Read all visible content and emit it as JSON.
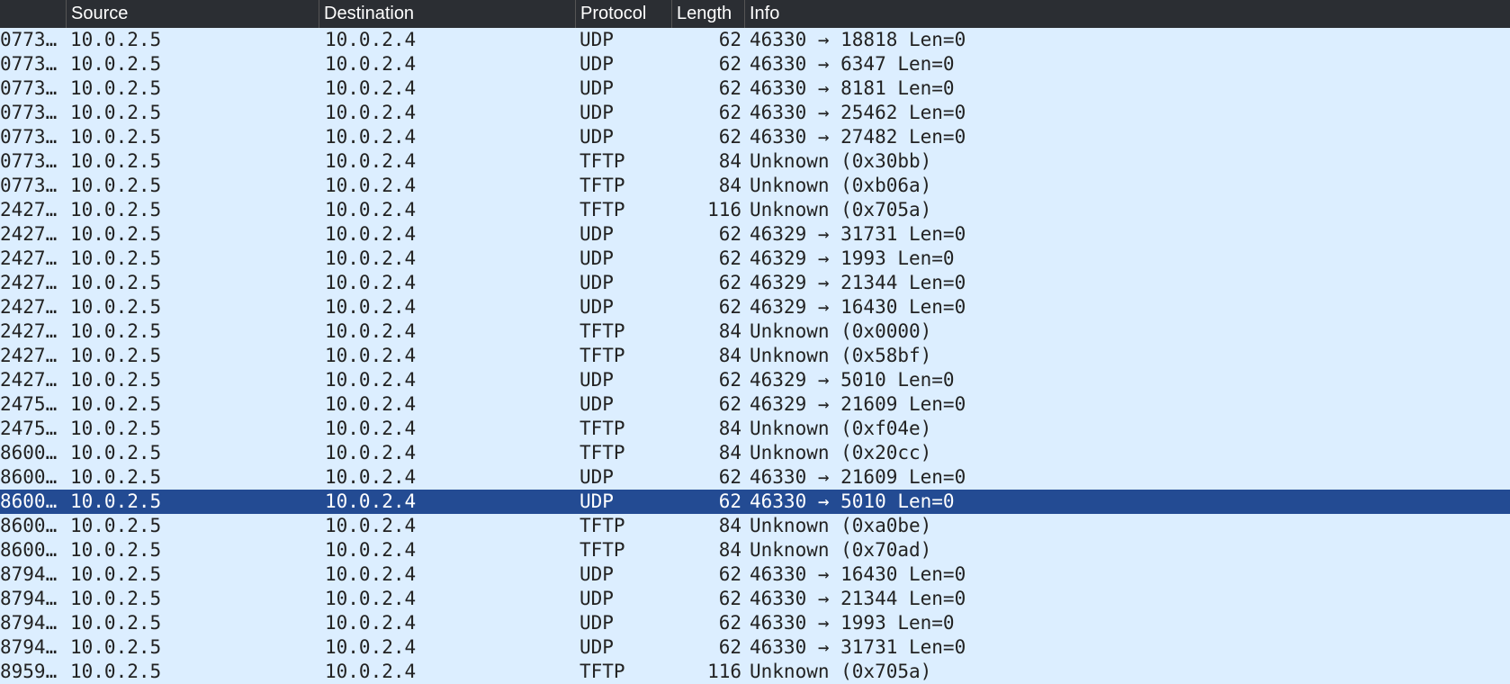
{
  "columns": {
    "time": "",
    "source": "Source",
    "destination": "Destination",
    "protocol": "Protocol",
    "length": "Length",
    "info": "Info"
  },
  "packets": [
    {
      "t": "0773…",
      "src": "10.0.2.5",
      "dst": "10.0.2.4",
      "proto": "UDP",
      "len": "62",
      "info": "46330 → 18818 Len=0"
    },
    {
      "t": "0773…",
      "src": "10.0.2.5",
      "dst": "10.0.2.4",
      "proto": "UDP",
      "len": "62",
      "info": "46330 → 6347 Len=0"
    },
    {
      "t": "0773…",
      "src": "10.0.2.5",
      "dst": "10.0.2.4",
      "proto": "UDP",
      "len": "62",
      "info": "46330 → 8181 Len=0"
    },
    {
      "t": "0773…",
      "src": "10.0.2.5",
      "dst": "10.0.2.4",
      "proto": "UDP",
      "len": "62",
      "info": "46330 → 25462 Len=0"
    },
    {
      "t": "0773…",
      "src": "10.0.2.5",
      "dst": "10.0.2.4",
      "proto": "UDP",
      "len": "62",
      "info": "46330 → 27482 Len=0"
    },
    {
      "t": "0773…",
      "src": "10.0.2.5",
      "dst": "10.0.2.4",
      "proto": "TFTP",
      "len": "84",
      "info": "Unknown (0x30bb)"
    },
    {
      "t": "0773…",
      "src": "10.0.2.5",
      "dst": "10.0.2.4",
      "proto": "TFTP",
      "len": "84",
      "info": "Unknown (0xb06a)"
    },
    {
      "t": "2427…",
      "src": "10.0.2.5",
      "dst": "10.0.2.4",
      "proto": "TFTP",
      "len": "116",
      "info": "Unknown (0x705a)"
    },
    {
      "t": "2427…",
      "src": "10.0.2.5",
      "dst": "10.0.2.4",
      "proto": "UDP",
      "len": "62",
      "info": "46329 → 31731 Len=0"
    },
    {
      "t": "2427…",
      "src": "10.0.2.5",
      "dst": "10.0.2.4",
      "proto": "UDP",
      "len": "62",
      "info": "46329 → 1993 Len=0"
    },
    {
      "t": "2427…",
      "src": "10.0.2.5",
      "dst": "10.0.2.4",
      "proto": "UDP",
      "len": "62",
      "info": "46329 → 21344 Len=0"
    },
    {
      "t": "2427…",
      "src": "10.0.2.5",
      "dst": "10.0.2.4",
      "proto": "UDP",
      "len": "62",
      "info": "46329 → 16430 Len=0"
    },
    {
      "t": "2427…",
      "src": "10.0.2.5",
      "dst": "10.0.2.4",
      "proto": "TFTP",
      "len": "84",
      "info": "Unknown (0x0000)"
    },
    {
      "t": "2427…",
      "src": "10.0.2.5",
      "dst": "10.0.2.4",
      "proto": "TFTP",
      "len": "84",
      "info": "Unknown (0x58bf)"
    },
    {
      "t": "2427…",
      "src": "10.0.2.5",
      "dst": "10.0.2.4",
      "proto": "UDP",
      "len": "62",
      "info": "46329 → 5010 Len=0"
    },
    {
      "t": "2475…",
      "src": "10.0.2.5",
      "dst": "10.0.2.4",
      "proto": "UDP",
      "len": "62",
      "info": "46329 → 21609 Len=0"
    },
    {
      "t": "2475…",
      "src": "10.0.2.5",
      "dst": "10.0.2.4",
      "proto": "TFTP",
      "len": "84",
      "info": "Unknown (0xf04e)"
    },
    {
      "t": "8600…",
      "src": "10.0.2.5",
      "dst": "10.0.2.4",
      "proto": "TFTP",
      "len": "84",
      "info": "Unknown (0x20cc)"
    },
    {
      "t": "8600…",
      "src": "10.0.2.5",
      "dst": "10.0.2.4",
      "proto": "UDP",
      "len": "62",
      "info": "46330 → 21609 Len=0"
    },
    {
      "t": "8600…",
      "src": "10.0.2.5",
      "dst": "10.0.2.4",
      "proto": "UDP",
      "len": "62",
      "info": "46330 → 5010 Len=0",
      "selected": true
    },
    {
      "t": "8600…",
      "src": "10.0.2.5",
      "dst": "10.0.2.4",
      "proto": "TFTP",
      "len": "84",
      "info": "Unknown (0xa0be)"
    },
    {
      "t": "8600…",
      "src": "10.0.2.5",
      "dst": "10.0.2.4",
      "proto": "TFTP",
      "len": "84",
      "info": "Unknown (0x70ad)"
    },
    {
      "t": "8794…",
      "src": "10.0.2.5",
      "dst": "10.0.2.4",
      "proto": "UDP",
      "len": "62",
      "info": "46330 → 16430 Len=0"
    },
    {
      "t": "8794…",
      "src": "10.0.2.5",
      "dst": "10.0.2.4",
      "proto": "UDP",
      "len": "62",
      "info": "46330 → 21344 Len=0"
    },
    {
      "t": "8794…",
      "src": "10.0.2.5",
      "dst": "10.0.2.4",
      "proto": "UDP",
      "len": "62",
      "info": "46330 → 1993 Len=0"
    },
    {
      "t": "8794…",
      "src": "10.0.2.5",
      "dst": "10.0.2.4",
      "proto": "UDP",
      "len": "62",
      "info": "46330 → 31731 Len=0"
    },
    {
      "t": "8959…",
      "src": "10.0.2.5",
      "dst": "10.0.2.4",
      "proto": "TFTP",
      "len": "116",
      "info": "Unknown (0x705a)"
    }
  ]
}
